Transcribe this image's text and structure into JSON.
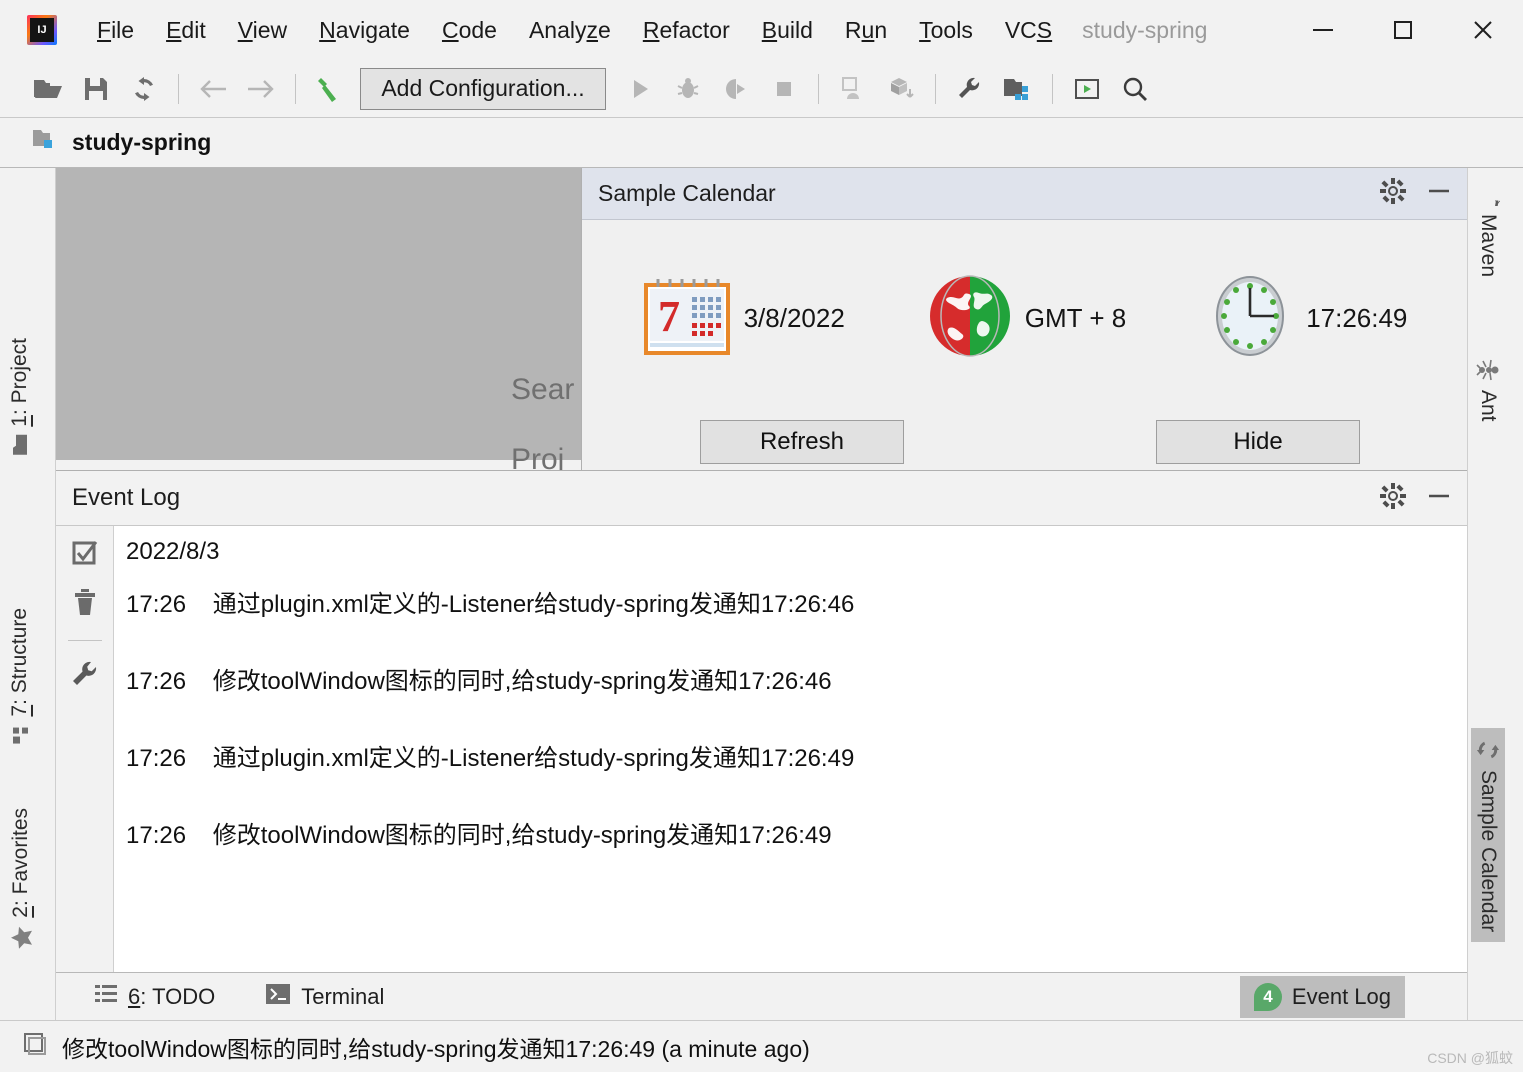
{
  "window": {
    "app_icon": "intellij-logo-icon",
    "project_title": "study-spring",
    "minimize_label": "–",
    "maximize_label": "□",
    "close_label": "✕"
  },
  "menubar": {
    "items": [
      {
        "pre": "",
        "mnemonic": "F",
        "post": "ile"
      },
      {
        "pre": "",
        "mnemonic": "E",
        "post": "dit"
      },
      {
        "pre": "",
        "mnemonic": "V",
        "post": "iew"
      },
      {
        "pre": "",
        "mnemonic": "N",
        "post": "avigate"
      },
      {
        "pre": "",
        "mnemonic": "C",
        "post": "ode"
      },
      {
        "pre": "Analy",
        "mnemonic": "z",
        "post": "e"
      },
      {
        "pre": "",
        "mnemonic": "R",
        "post": "efactor"
      },
      {
        "pre": "",
        "mnemonic": "B",
        "post": "uild"
      },
      {
        "pre": "R",
        "mnemonic": "u",
        "post": "n"
      },
      {
        "pre": "",
        "mnemonic": "T",
        "post": "ools"
      },
      {
        "pre": "VC",
        "mnemonic": "S",
        "post": ""
      }
    ]
  },
  "toolbar": {
    "add_configuration_label": "Add Configuration...",
    "icons": [
      "open-folder-icon",
      "save-icon",
      "sync-icon",
      "back-arrow-icon",
      "forward-arrow-icon",
      "build-hammer-icon",
      "run-icon",
      "debug-icon",
      "run-coverage-icon",
      "stop-icon",
      "profiler-icon",
      "update-project-icon",
      "settings-wrench-icon",
      "project-structure-icon",
      "run-anything-icon",
      "search-everywhere-icon"
    ]
  },
  "breadcrumb": {
    "icon": "project-folder-icon",
    "label": "study-spring"
  },
  "editor": {
    "hint_line1": "Sear",
    "hint_line2": "Proj"
  },
  "left_tool_strip": {
    "tabs": [
      {
        "num": "1",
        "label": ": Project",
        "icon": "folder-icon"
      },
      {
        "num": "7",
        "label": ": Structure",
        "icon": "structure-squares-icon"
      },
      {
        "num": "2",
        "label": ": Favorites",
        "icon": "star-icon"
      }
    ]
  },
  "right_tool_strip": {
    "tabs": [
      {
        "label": "Maven",
        "icon": "maven-m-icon"
      },
      {
        "label": "Ant",
        "icon": "ant-icon"
      },
      {
        "label": "Sample Calendar",
        "icon": "sync-icon",
        "active": true
      }
    ]
  },
  "calendar_window": {
    "title": "Sample Calendar",
    "gear_icon": "gear-icon",
    "minimize_icon": "minimize-icon",
    "date_icon": "calendar-icon",
    "date_value": "3/8/2022",
    "timezone_icon": "globe-icon",
    "timezone_value": "GMT + 8",
    "time_icon": "clock-icon",
    "time_value": "17:26:49",
    "refresh_button": "Refresh",
    "hide_button": "Hide"
  },
  "event_log": {
    "title": "Event Log",
    "gear_icon": "gear-icon",
    "minimize_icon": "minimize-icon",
    "toolbar_icons": [
      "mark-all-read-icon",
      "delete-icon",
      "settings-wrench-icon"
    ],
    "date_header": "2022/8/3",
    "entries": [
      {
        "time": "17:26",
        "message": "通过plugin.xml定义的-Listener给study-spring发通知17:26:46"
      },
      {
        "time": "17:26",
        "message": "修改toolWindow图标的同时,给study-spring发通知17:26:46"
      },
      {
        "time": "17:26",
        "message": "通过plugin.xml定义的-Listener给study-spring发通知17:26:49"
      },
      {
        "time": "17:26",
        "message": "修改toolWindow图标的同时,给study-spring发通知17:26:49"
      }
    ]
  },
  "bottom_bar": {
    "todo": {
      "num": "6",
      "label": ": TODO",
      "icon": "todo-list-icon"
    },
    "terminal": {
      "label": "Terminal",
      "icon": "terminal-icon"
    },
    "event_log_tab": {
      "label": "Event Log",
      "badge": "4",
      "badge_color": "#59a869"
    }
  },
  "status_bar": {
    "icon": "notification-icon",
    "text": "修改toolWindow图标的同时,给study-spring发通知17:26:49 (a minute ago)"
  },
  "watermark": "CSDN @狐蚊"
}
